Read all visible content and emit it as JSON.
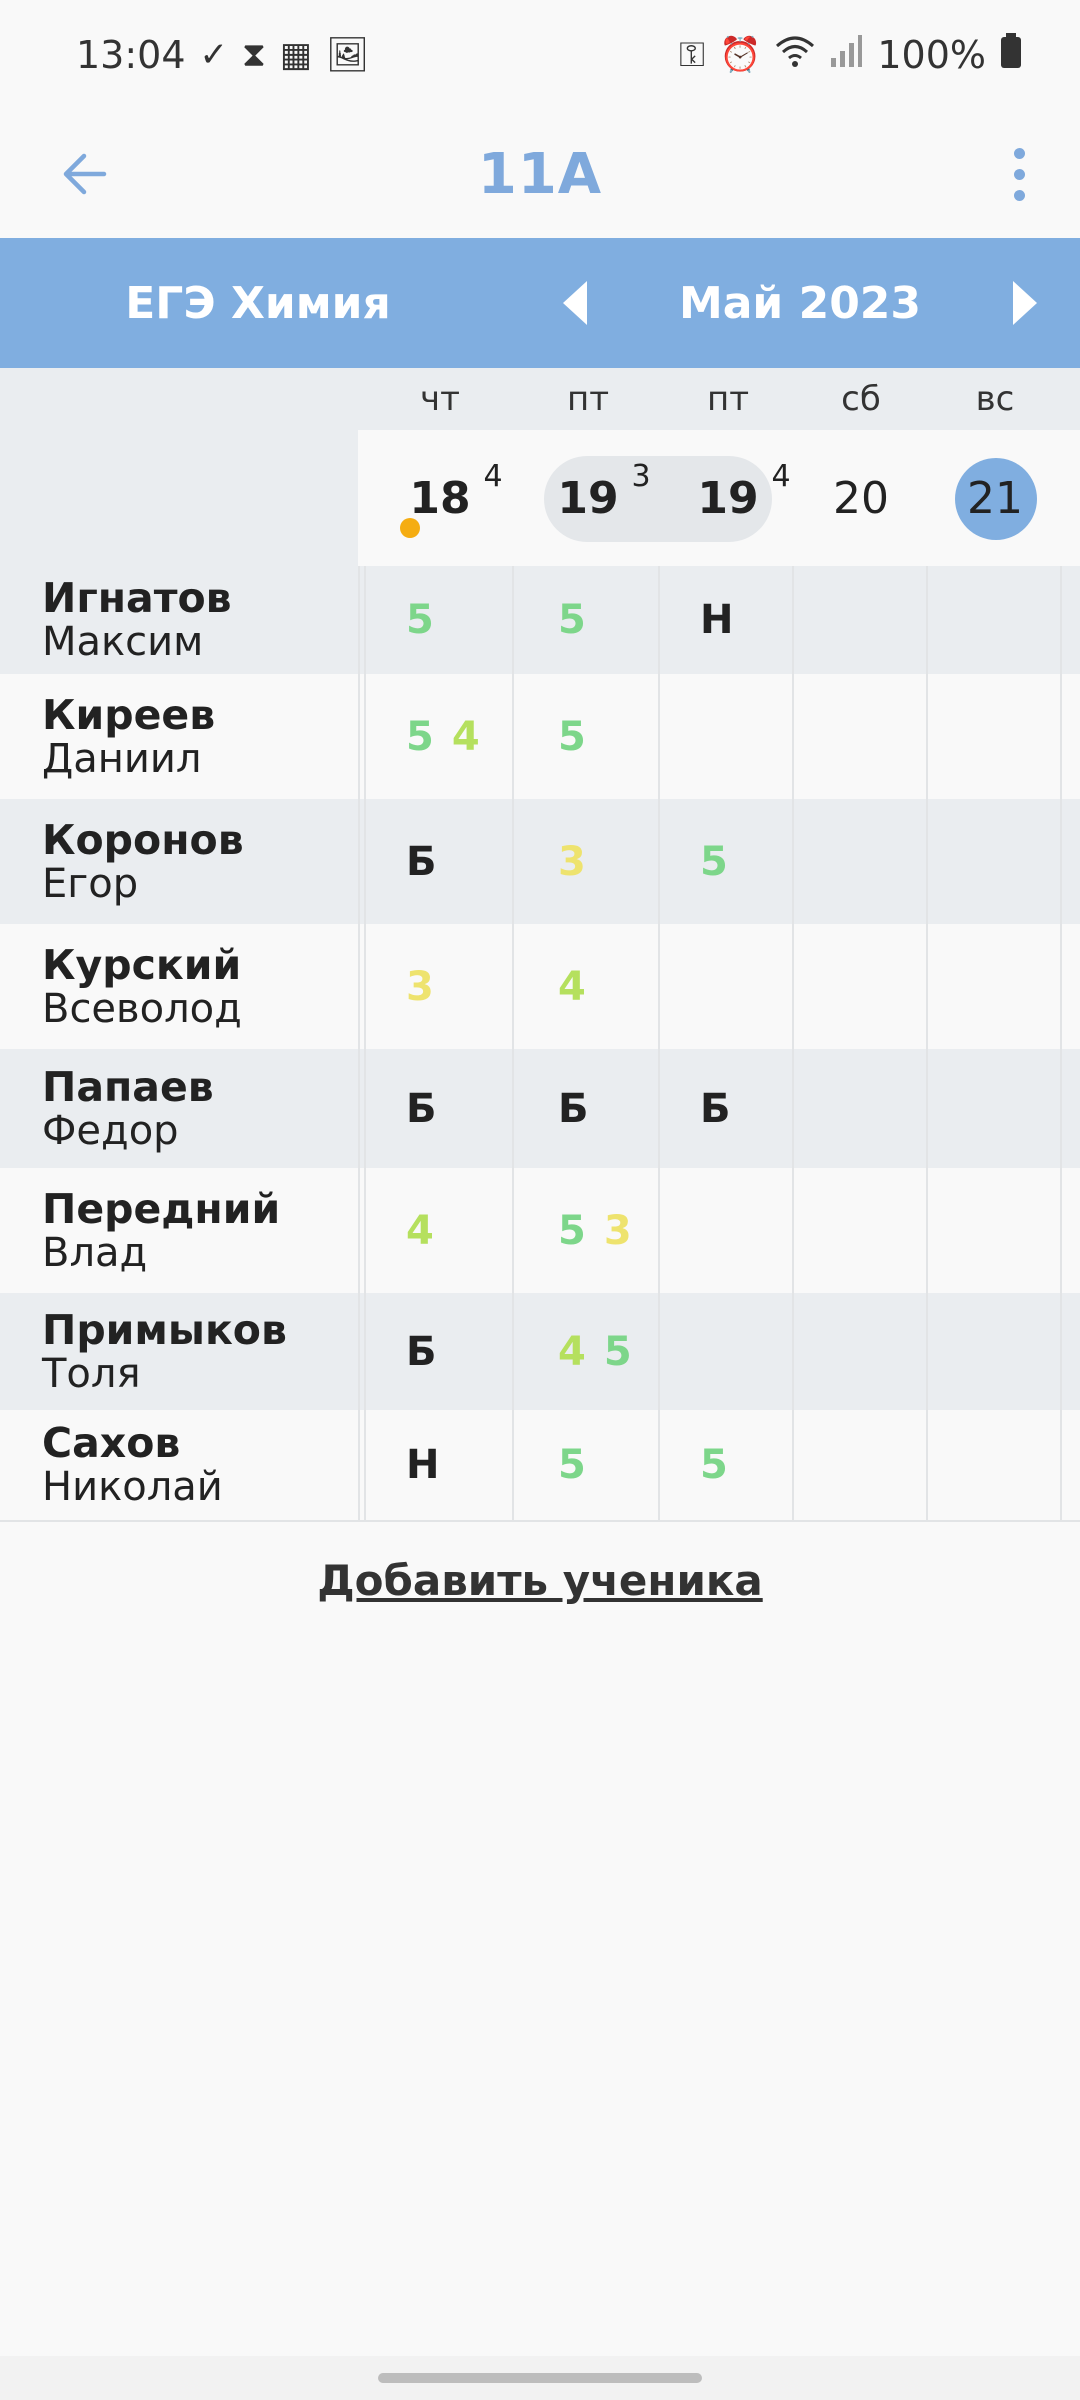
{
  "status_bar": {
    "time": "13:04",
    "left_icons": [
      "check-icon",
      "hourglass-icon",
      "grid-app-icon",
      "image-icon"
    ],
    "right_icons": [
      "vpn-key-icon",
      "alarm-icon",
      "wifi-icon",
      "signal-icon",
      "battery-icon"
    ],
    "battery": "100%"
  },
  "app_bar": {
    "title": "11А"
  },
  "subject": "ЕГЭ Химия",
  "month": "Май 2023",
  "columns": [
    {
      "weekday": "чт",
      "day": "18",
      "lessons": "4"
    },
    {
      "weekday": "пт",
      "day": "19",
      "lessons": "3"
    },
    {
      "weekday": "пт",
      "day": "19",
      "lessons": "4"
    },
    {
      "weekday": "сб",
      "day": "20",
      "lessons": ""
    },
    {
      "weekday": "вс",
      "day": "21",
      "lessons": ""
    }
  ],
  "colors": {
    "accent": "#80aee0",
    "grade5": "#7dd68a",
    "grade4": "#b5e05e",
    "grade3": "#eee36e",
    "marker": "#f5ad12"
  },
  "students": [
    {
      "surname": "Игнатов",
      "name": "Максим",
      "marks": [
        [
          "5"
        ],
        [
          "5"
        ],
        [
          "Н"
        ],
        [],
        []
      ]
    },
    {
      "surname": "Киреев",
      "name": "Даниил",
      "marks": [
        [
          "5",
          "4"
        ],
        [
          "5"
        ],
        [],
        [],
        []
      ]
    },
    {
      "surname": "Коронов",
      "name": "Егор",
      "marks": [
        [
          "Б"
        ],
        [
          "3"
        ],
        [
          "5"
        ],
        [],
        []
      ]
    },
    {
      "surname": "Курский",
      "name": "Всеволод",
      "marks": [
        [
          "3"
        ],
        [
          "4"
        ],
        [],
        [],
        []
      ]
    },
    {
      "surname": "Папаев",
      "name": "Федор",
      "marks": [
        [
          "Б"
        ],
        [
          "Б"
        ],
        [
          "Б"
        ],
        [],
        []
      ]
    },
    {
      "surname": "Передний",
      "name": "Влад",
      "marks": [
        [
          "4"
        ],
        [
          "5",
          "3"
        ],
        [],
        [],
        []
      ]
    },
    {
      "surname": "Примыков",
      "name": "Толя",
      "marks": [
        [
          "Б"
        ],
        [
          "4",
          "5"
        ],
        [],
        [],
        []
      ]
    },
    {
      "surname": "Сахов",
      "name": "Николай",
      "marks": [
        [
          "Н"
        ],
        [
          "5"
        ],
        [
          "5"
        ],
        [],
        []
      ]
    }
  ],
  "add_student": "Добавить ученика"
}
